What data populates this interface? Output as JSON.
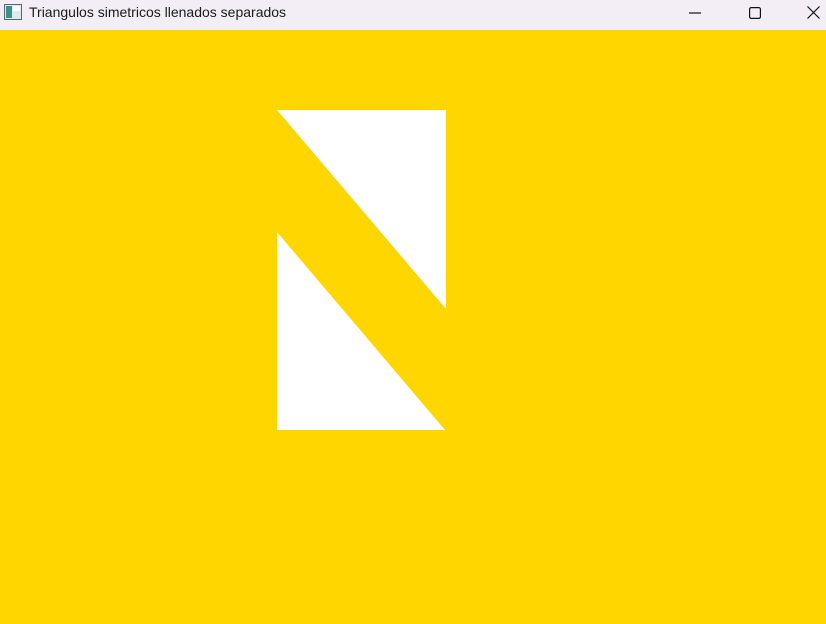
{
  "window": {
    "title": "Triangulos simetricos llenados separados",
    "icon": "app-window-icon"
  },
  "controls": {
    "minimize_icon": "minimize-icon",
    "maximize_icon": "maximize-icon",
    "close_icon": "close-icon"
  },
  "colors": {
    "background": "#ffd600",
    "shape_fill": "#ffffff",
    "titlebar": "#f3eef5"
  }
}
